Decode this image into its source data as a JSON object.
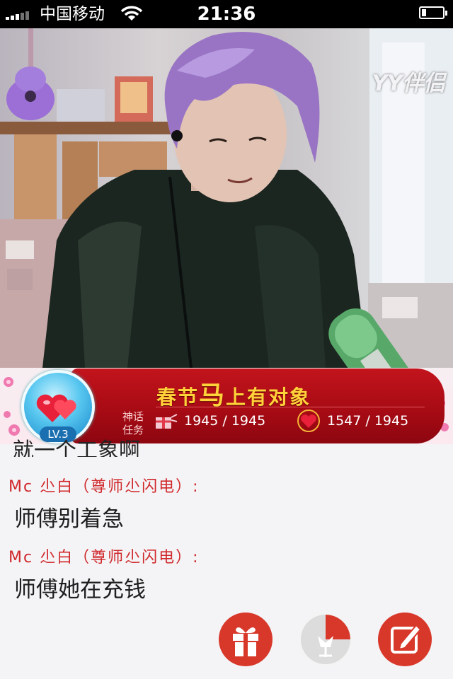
{
  "status_bar": {
    "carrier": "中国移动",
    "time": "21:36",
    "signal_icon": "signal-bars-icon",
    "wifi_icon": "wifi-icon",
    "battery_icon": "battery-icon"
  },
  "video": {
    "watermark": "YY伴侣"
  },
  "banner": {
    "title_pre": "春节",
    "title_big": "马",
    "title_post": "上有对象",
    "task_tag_line1": "神话",
    "task_tag_line2": "任务",
    "counter1": "1945  /  1945",
    "counter2": "1547  /  1945",
    "level": "LV.3"
  },
  "chat": {
    "partial_line": "就一个工象啊",
    "messages": [
      {
        "name": "Mc 尐白（尊师尐闪电）:",
        "text": "师傅别着急"
      },
      {
        "name": "Mc 尐白（尊师尐闪电）:",
        "text": "师傅她在充钱"
      }
    ]
  },
  "actions": {
    "gift_icon": "gift-icon",
    "flower_icon": "flower-icon",
    "edit_icon": "edit-icon",
    "accent_color": "#d8382a"
  }
}
